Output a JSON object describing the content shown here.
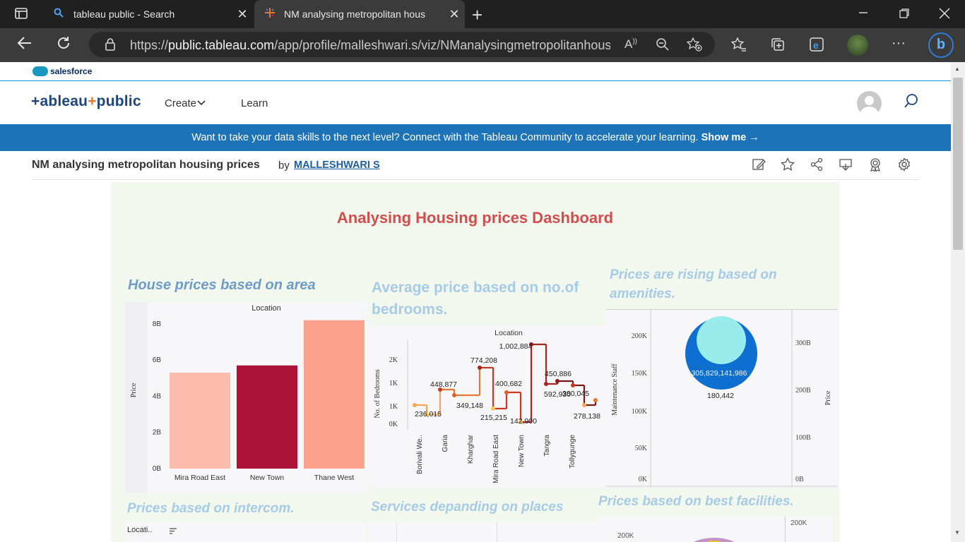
{
  "browser": {
    "tabs": [
      {
        "title": "tableau public - Search",
        "close": "✕"
      },
      {
        "title": "NM analysing metropolitan hous",
        "close": "✕"
      }
    ],
    "new_tab": "+",
    "url_scheme": "https://",
    "url_host": "public.tableau.com",
    "url_path": "/app/profile/malleshwari.s/viz/NManalysingmetropolitanhousi...",
    "read_aloud": "A̵"
  },
  "salesforce": {
    "label": "salesforce"
  },
  "header": {
    "logo_pre": "+ableau",
    "logo_plus": "+",
    "logo_post": "public",
    "nav": [
      {
        "label": "Create"
      },
      {
        "label": "Learn"
      }
    ]
  },
  "banner": {
    "text": "Want to take your data skills to the next level? Connect with the Tableau Community to accelerate your learning.",
    "cta": "Show me →"
  },
  "viz": {
    "title": "NM analysing metropolitan housing prices",
    "by": "by",
    "author": "MALLESHWARI S"
  },
  "dashboard": {
    "title": "Analysing Housing prices Dashboard",
    "sheets": {
      "area": "House prices based on area",
      "bedrooms_l1": "Average price based on no.of",
      "bedrooms_l2": "bedrooms.",
      "amenities_l1": "Prices are rising based on",
      "amenities_l2": "amenities.",
      "intercom": "Prices based on intercom.",
      "services": "Services depanding on places",
      "facilities": "Prices based on best facilities."
    },
    "intercom_header": "Locati..",
    "facilities_ticks": [
      "200K",
      "200K"
    ]
  },
  "chart_data": [
    {
      "type": "bar",
      "title": "House prices based on area",
      "column_header": "Location",
      "ylabel": "Price",
      "categories": [
        "Mira Road East",
        "New Town",
        "Thane West"
      ],
      "values": [
        5.3,
        5.7,
        8.2
      ],
      "value_unit": "B",
      "yticks": [
        "8B",
        "6B",
        "4B",
        "2B",
        "0B"
      ],
      "ylim": [
        0,
        8.5
      ],
      "colors": [
        "#fcbcad",
        "#ad1338",
        "#fca18a"
      ]
    },
    {
      "type": "line",
      "title": "Average price based on no.of bedrooms.",
      "column_header": "Location",
      "ylabel": "No. of Bedrooms",
      "yticks": [
        "2K",
        "1K",
        "1K",
        "0K"
      ],
      "categories": [
        "Borivali We..",
        "Garia",
        "Kharghar",
        "Mira Road East",
        "New Town",
        "Tangra",
        "Tollygunge"
      ],
      "labels": [
        "236,015",
        "448,877",
        "349,148",
        "774,208",
        "215,215",
        "400,682",
        "142,900",
        "1,002,884",
        "450,886",
        "592,930",
        "380,045",
        "278,138"
      ]
    },
    {
      "type": "scatter",
      "title": "Prices are rising based on amenities.",
      "ylabel_left": "Maintenance Staff",
      "ylabel_right": "Price",
      "yticks_left": [
        "200K",
        "150K",
        "100K",
        "50K",
        "0K"
      ],
      "yticks_right": [
        "300B",
        "200B",
        "100B",
        "0B"
      ],
      "labels": [
        "305,829,141,986",
        "180,442"
      ],
      "colors": [
        "#0f6fd1",
        "#99ecec"
      ]
    }
  ]
}
